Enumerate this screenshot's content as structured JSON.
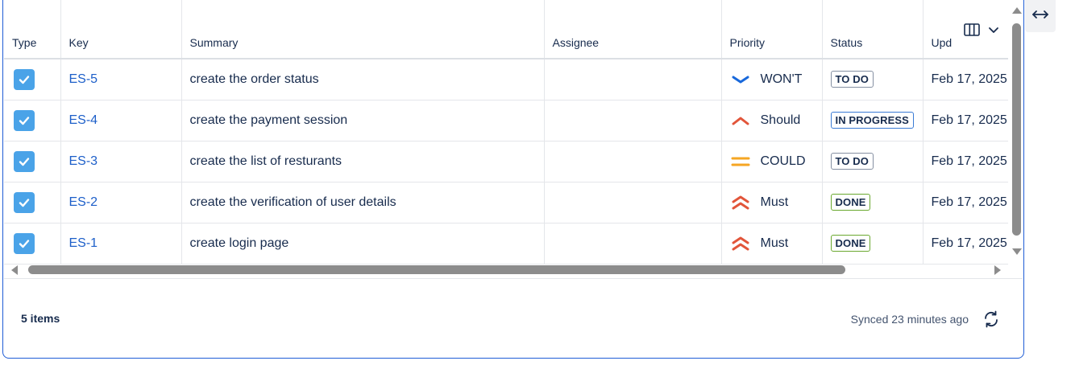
{
  "columns": [
    "Type",
    "Key",
    "Summary",
    "Assignee",
    "Priority",
    "Status",
    "Upd"
  ],
  "rows": [
    {
      "key": "ES-5",
      "summary": "create the order status",
      "assignee": "",
      "priority": "WON'T",
      "priority_icon": "chevron-down-icon",
      "status": "TO DO",
      "updated": "Feb 17, 2025"
    },
    {
      "key": "ES-4",
      "summary": "create the payment session",
      "assignee": "",
      "priority": "Should",
      "priority_icon": "chevron-up-icon",
      "status": "IN PROGRESS",
      "updated": "Feb 17, 2025"
    },
    {
      "key": "ES-3",
      "summary": "create the list of resturants",
      "assignee": "",
      "priority": "COULD",
      "priority_icon": "equals-icon",
      "status": "TO DO",
      "updated": "Feb 17, 2025"
    },
    {
      "key": "ES-2",
      "summary": "create the verification of user details",
      "assignee": "",
      "priority": "Must",
      "priority_icon": "double-chevron-up-icon",
      "status": "DONE",
      "updated": "Feb 17, 2025"
    },
    {
      "key": "ES-1",
      "summary": "create login page",
      "assignee": "",
      "priority": "Must",
      "priority_icon": "double-chevron-up-icon",
      "status": "DONE",
      "updated": "Feb 17, 2025"
    }
  ],
  "footer": {
    "items_count": "5 items",
    "synced": "Synced 23 minutes ago"
  },
  "icons": {
    "column_picker": "columns-icon",
    "expand": "expand-horizontal-icon",
    "refresh": "refresh-icon"
  },
  "colors": {
    "link": "#1d5fc9",
    "checkbox": "#4aa3e8",
    "prio_low": "#1868db",
    "prio_high": "#e2553a",
    "prio_medium": "#f5a623",
    "panel_border": "#1f5dd6"
  }
}
